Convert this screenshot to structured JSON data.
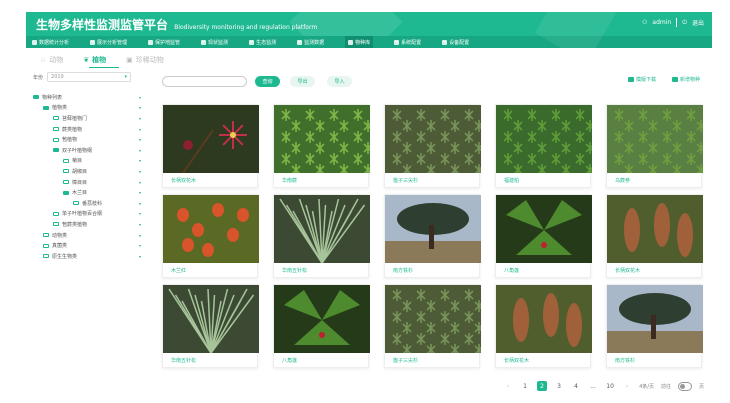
{
  "header": {
    "title": "生物多样性监测监管平台",
    "subtitle": "Biodiversity monitoring and regulation platform",
    "user": "admin",
    "logout": "退出"
  },
  "nav": [
    {
      "label": "数据统计分析"
    },
    {
      "label": "展示分析管理"
    },
    {
      "label": "保护地监管"
    },
    {
      "label": "现状监测"
    },
    {
      "label": "生态监测"
    },
    {
      "label": "监测数据"
    },
    {
      "label": "物种库"
    },
    {
      "label": "系统配置"
    },
    {
      "label": "设备配置"
    }
  ],
  "tabs": [
    {
      "label": "动物"
    },
    {
      "label": "植物"
    },
    {
      "label": "珍稀动物"
    }
  ],
  "sidebar": {
    "year_label": "年份",
    "year_value": "2019",
    "tree": [
      {
        "label": "物种列表",
        "level": 0,
        "filled": true
      },
      {
        "label": "植物类",
        "level": 1,
        "filled": true
      },
      {
        "label": "苔藓植物门",
        "level": 2,
        "filled": false
      },
      {
        "label": "蕨类植物",
        "level": 2,
        "filled": false
      },
      {
        "label": "苞植物",
        "level": 2,
        "filled": false
      },
      {
        "label": "双子叶植物纲",
        "level": 2,
        "filled": true
      },
      {
        "label": "菊目",
        "level": 3,
        "filled": false
      },
      {
        "label": "胡椒目",
        "level": 3,
        "filled": false
      },
      {
        "label": "樟目目",
        "level": 3,
        "filled": false
      },
      {
        "label": "木兰目",
        "level": 3,
        "filled": true
      },
      {
        "label": "番荔枝科",
        "level": 4,
        "filled": false
      },
      {
        "label": "单子叶植物百合纲",
        "level": 2,
        "filled": false
      },
      {
        "label": "苞蕨类植物",
        "level": 2,
        "filled": false
      },
      {
        "label": "动物类",
        "level": 1,
        "filled": false
      },
      {
        "label": "真菌类",
        "level": 1,
        "filled": false
      },
      {
        "label": "原生生物类",
        "level": 1,
        "filled": false
      }
    ]
  },
  "toolbar": {
    "search_placeholder": "",
    "query": "查询",
    "export": "导出",
    "import": "导入",
    "template_download": "模版下载",
    "add_species": "新增物种"
  },
  "cards": [
    {
      "label": "长柄双花木",
      "theme": "flower"
    },
    {
      "label": "华南蕨",
      "theme": "fern"
    },
    {
      "label": "篦子三尖杉",
      "theme": "conifer"
    },
    {
      "label": "福建柏",
      "theme": "fir"
    },
    {
      "label": "乌蕨参",
      "theme": "fern2"
    },
    {
      "label": "木兰红",
      "theme": "berry"
    },
    {
      "label": "华南五针松",
      "theme": "pine"
    },
    {
      "label": "南方铁杉",
      "theme": "tree"
    },
    {
      "label": "八角莲",
      "theme": "lotus"
    },
    {
      "label": "长柄双花木",
      "theme": "cone"
    },
    {
      "label": "华南五针松",
      "theme": "pine"
    },
    {
      "label": "八角莲",
      "theme": "lotus"
    },
    {
      "label": "篦子三尖杉",
      "theme": "conifer"
    },
    {
      "label": "长柄双花木",
      "theme": "cone"
    },
    {
      "label": "南方铁杉",
      "theme": "tree"
    }
  ],
  "pagination": {
    "pages": [
      "1",
      "2",
      "3",
      "4",
      "...",
      "10"
    ],
    "current": "2",
    "per_page": "4条/页",
    "goto": "前往",
    "page_unit": "页"
  },
  "colors": {
    "accent": "#1fb991",
    "nav": "#17a883"
  }
}
